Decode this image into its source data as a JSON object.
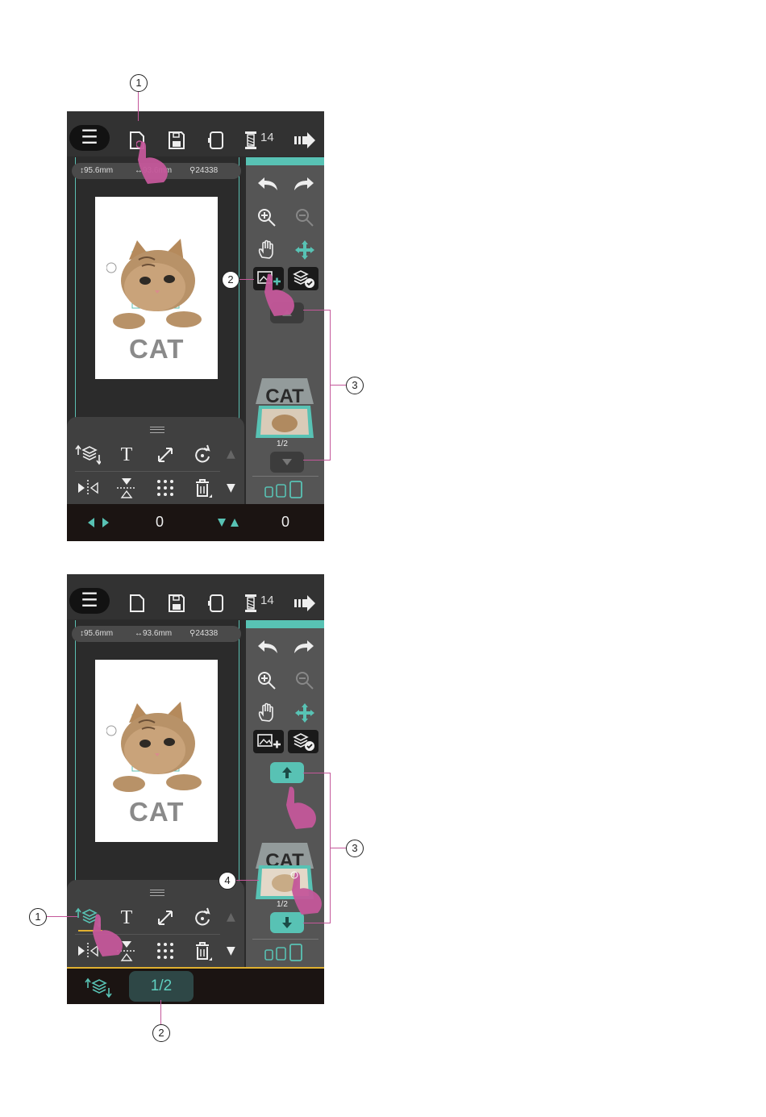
{
  "toolbar": {
    "menu_icon": "☰",
    "thread_count": "14"
  },
  "design_info": {
    "height": "95.6mm",
    "width": "93.6mm",
    "stitches": "24338"
  },
  "design": {
    "text": "CAT"
  },
  "layers": {
    "page": "1/2"
  },
  "position": {
    "x": "0",
    "y": "0"
  },
  "tools": {
    "text_icon": "T"
  },
  "callouts": [
    "1",
    "2",
    "3",
    "4"
  ],
  "colors": {
    "accent": "#58c2b4",
    "callout_line": "#c4579a",
    "finger": "#c4579a"
  }
}
